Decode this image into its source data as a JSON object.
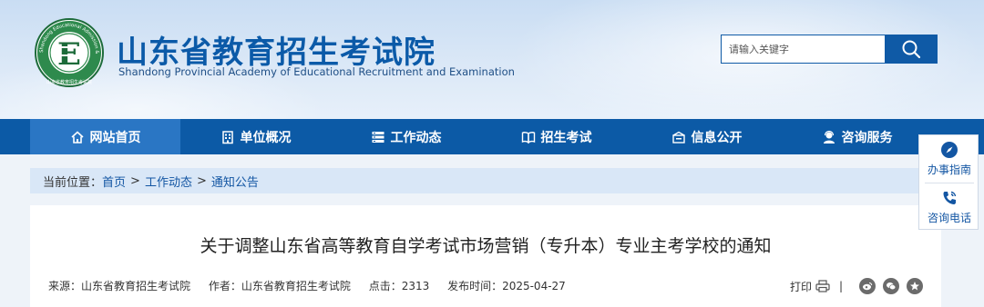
{
  "header": {
    "title": "山东省教育招生考试院",
    "subtitle": "Shandong Provincial Academy of Educational Recruitment and Examination",
    "logo_ring_text": "Shandong Educational Admission & Examination",
    "logo_letter": "E",
    "logo_bottom_text": "山东省教育招生考试院"
  },
  "search": {
    "placeholder": "请输入关键字",
    "icon": "search-icon"
  },
  "nav": {
    "items": [
      {
        "label": "网站首页",
        "icon": "home-icon",
        "active": true
      },
      {
        "label": "单位概况",
        "icon": "building-icon"
      },
      {
        "label": "工作动态",
        "icon": "list-icon"
      },
      {
        "label": "招生考试",
        "icon": "book-icon"
      },
      {
        "label": "信息公开",
        "icon": "notice-icon"
      },
      {
        "label": "咨询服务",
        "icon": "user-service-icon"
      }
    ]
  },
  "breadcrumb": {
    "prefix": "当前位置：",
    "items": [
      "首页",
      "工作动态",
      "通知公告"
    ],
    "separator": ">"
  },
  "article": {
    "title": "关于调整山东省高等教育自学考试市场营销（专升本）专业主考学校的通知",
    "source": "来源：山东省教育招生考试院",
    "author": "作者：山东省教育招生考试院",
    "clicks": "点击：2313",
    "publish_time": "发布时间：2025-04-27"
  },
  "tools": {
    "print_label": "打印",
    "divider": "|"
  },
  "float_bar": {
    "items": [
      {
        "label": "办事指南",
        "icon": "compass-icon"
      },
      {
        "label": "咨询电话",
        "icon": "phone-icon"
      }
    ]
  },
  "colors": {
    "brand": "#0c5aa6",
    "nav_active": "#2a76c4",
    "title": "#0b5aa8",
    "link": "#1356a3"
  }
}
